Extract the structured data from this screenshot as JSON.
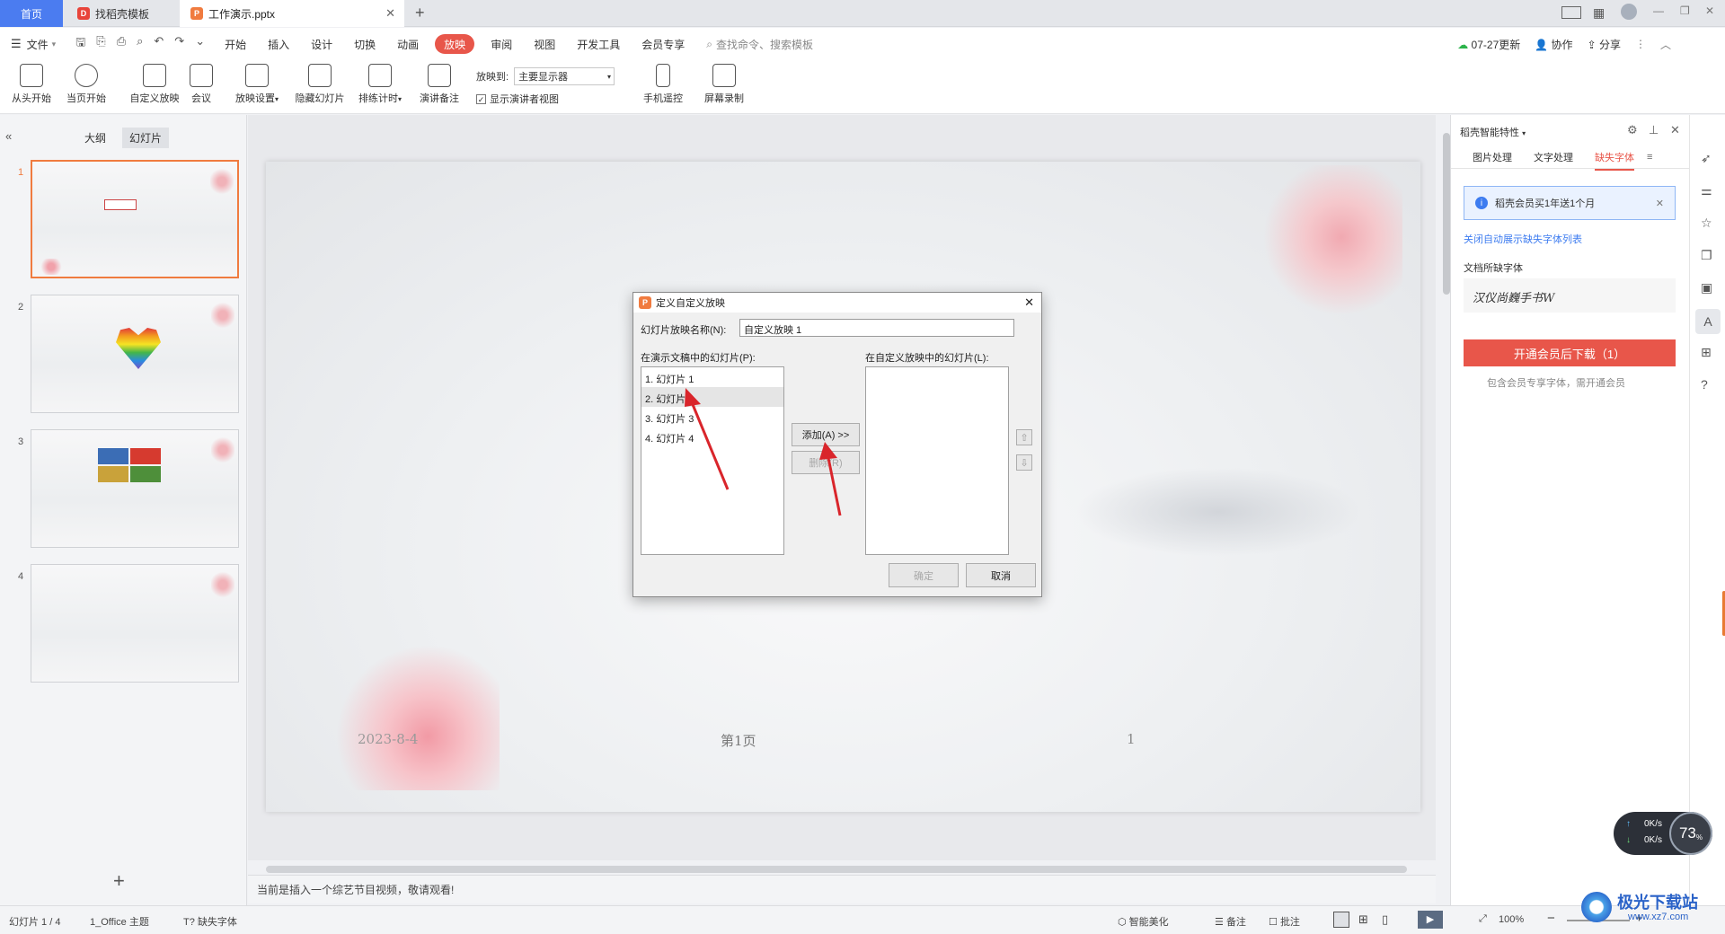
{
  "tabs": {
    "home": "首页",
    "template": "找稻壳模板",
    "document": "工作演示.pptx"
  },
  "menu": {
    "file": "文件",
    "items": [
      "开始",
      "插入",
      "设计",
      "切换",
      "动画",
      "放映",
      "审阅",
      "视图",
      "开发工具",
      "会员专享"
    ],
    "search": "查找命令、搜索模板",
    "update": "07-27更新",
    "collab": "协作",
    "share": "分享"
  },
  "ribbon": {
    "buttons": [
      "从头开始",
      "当页开始",
      "自定义放映",
      "会议",
      "放映设置",
      "隐藏幻灯片",
      "排练计时",
      "演讲备注",
      "手机遥控",
      "屏幕录制"
    ],
    "show_to_label": "放映到:",
    "show_to_value": "主要显示器",
    "presenter_view": "显示演讲者视图"
  },
  "left_panel": {
    "tab_outline": "大纲",
    "tab_slides": "幻灯片",
    "slide_numbers": [
      "1",
      "2",
      "3",
      "4"
    ]
  },
  "slide": {
    "date": "2023-8-4",
    "page_text": "第1页",
    "number": "1"
  },
  "dialog": {
    "title": "定义自定义放映",
    "name_label": "幻灯片放映名称(N):",
    "name_value": "自定义放映 1",
    "left_list_label": "在演示文稿中的幻灯片(P):",
    "right_list_label": "在自定义放映中的幻灯片(L):",
    "slides": [
      "1. 幻灯片 1",
      "2. 幻灯片 2",
      "3. 幻灯片 3",
      "4. 幻灯片 4"
    ],
    "add_button": "添加(A) >>",
    "remove_button": "删除(R)",
    "ok_button": "确定",
    "cancel_button": "取消"
  },
  "right_panel": {
    "title": "稻壳智能特性",
    "tabs": [
      "图片处理",
      "文字处理",
      "缺失字体"
    ],
    "notice": "稻壳会员买1年送1个月",
    "close_link": "关闭自动展示缺失字体列表",
    "missing_label": "文档所缺字体",
    "font_sample": "汉仪尚巍手书W",
    "download_button": "开通会员后下载（1）",
    "note": "包含会员专享字体，需开通会员"
  },
  "notes_text": "当前是插入一个综艺节目视频，敬请观看!",
  "status": {
    "slide_info": "幻灯片 1 / 4",
    "theme": "1_Office 主题",
    "missing_font": "缺失字体",
    "beautify": "智能美化",
    "notes": "备注",
    "comment": "批注",
    "zoom": "100%"
  },
  "speed": {
    "up": "0K/s",
    "down": "0K/s",
    "percent": "73"
  },
  "watermark": {
    "brand": "极光下载站",
    "url": "www.xz7.com"
  },
  "colors": {
    "accent": "#e8564a",
    "home_tab": "#4b7cf0",
    "selected_border": "#f07b3f",
    "link": "#3d7cf0"
  }
}
